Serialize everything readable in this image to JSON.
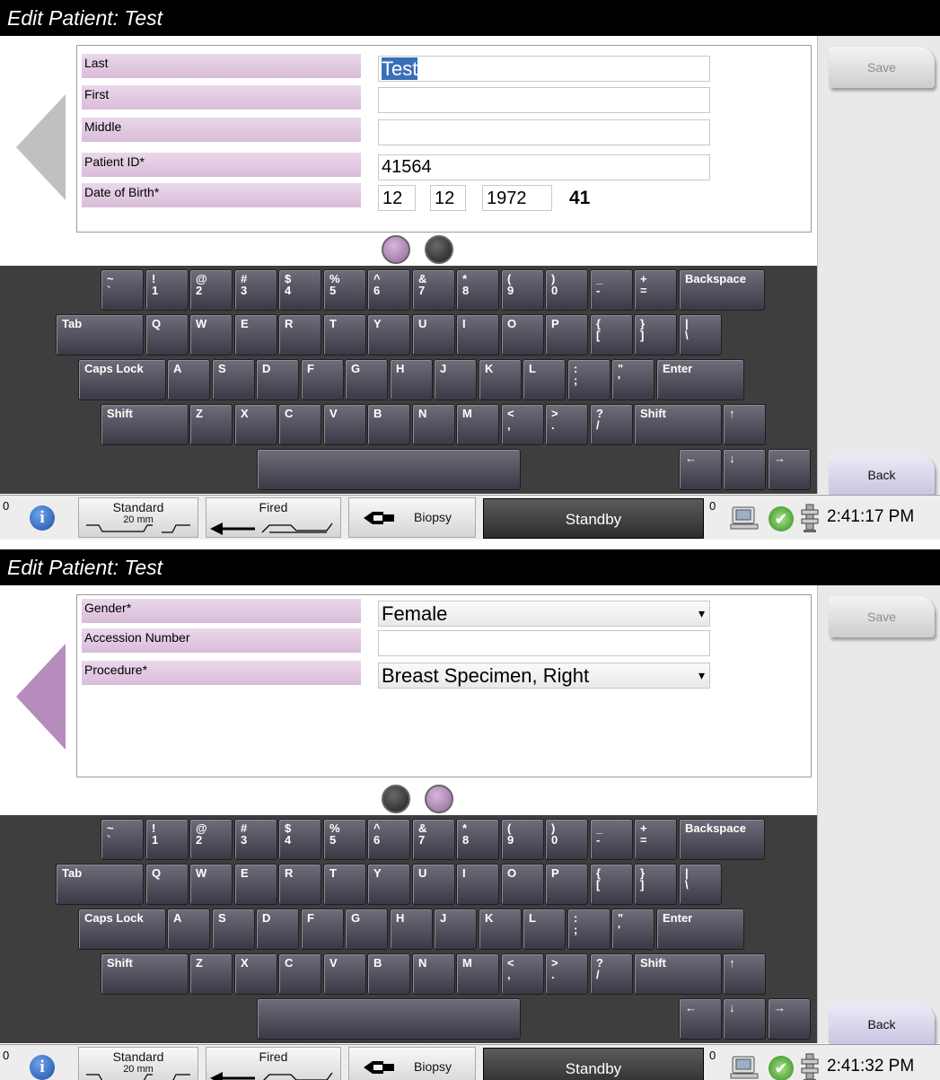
{
  "screens": [
    {
      "title": "Edit Patient: Test",
      "fields": [
        {
          "label": "Last",
          "value": "Test"
        },
        {
          "label": "First",
          "value": ""
        },
        {
          "label": "Middle",
          "value": ""
        },
        {
          "label": "Patient ID*",
          "value": "41564"
        },
        {
          "label": "Date of Birth*",
          "month": "12",
          "day": "12",
          "year": "1972",
          "age": "41"
        }
      ],
      "page_indicator": {
        "active_page": 1,
        "total_pages": 2
      },
      "save_label": "Save",
      "back_label": "Back",
      "time": "2:41:17 PM"
    },
    {
      "title": "Edit Patient: Test",
      "fields": [
        {
          "label": "Gender*",
          "value": "Female"
        },
        {
          "label": "Accession Number",
          "value": ""
        },
        {
          "label": "Procedure*",
          "value": "Breast Specimen, Right"
        }
      ],
      "page_indicator": {
        "active_page": 2,
        "total_pages": 2
      },
      "save_label": "Save",
      "back_label": "Back",
      "time": "2:41:32 PM"
    }
  ],
  "keyboard": {
    "row1": [
      "~\n`",
      "!\n1",
      "@\n2",
      "#\n3",
      "$\n4",
      "%\n5",
      "^\n6",
      "&\n7",
      "*\n8",
      "(\n9",
      ")\n0",
      "_\n-",
      "+\n=",
      "Backspace"
    ],
    "row2": [
      "Tab",
      "Q",
      "W",
      "E",
      "R",
      "T",
      "Y",
      "U",
      "I",
      "O",
      "P",
      "{\n[",
      "}\n]",
      "|\n\\"
    ],
    "row3": [
      "Caps Lock",
      "A",
      "S",
      "D",
      "F",
      "G",
      "H",
      "J",
      "K",
      "L",
      ":\n;",
      "\"\n'",
      "Enter"
    ],
    "row4": [
      "Shift",
      "Z",
      "X",
      "C",
      "V",
      "B",
      "N",
      "M",
      "<\n,",
      ">\n.",
      "?\n/",
      "Shift",
      "↑"
    ],
    "row5": [
      "",
      "←",
      "↓",
      "→"
    ]
  },
  "status_bar": {
    "left_count": "0",
    "info_icon": "info-icon",
    "compression_mode": "Standard",
    "compression_size": "20 mm",
    "fire_state": "Fired",
    "procedure_mode": "Biopsy",
    "state": "Standby",
    "right_count": "0"
  }
}
